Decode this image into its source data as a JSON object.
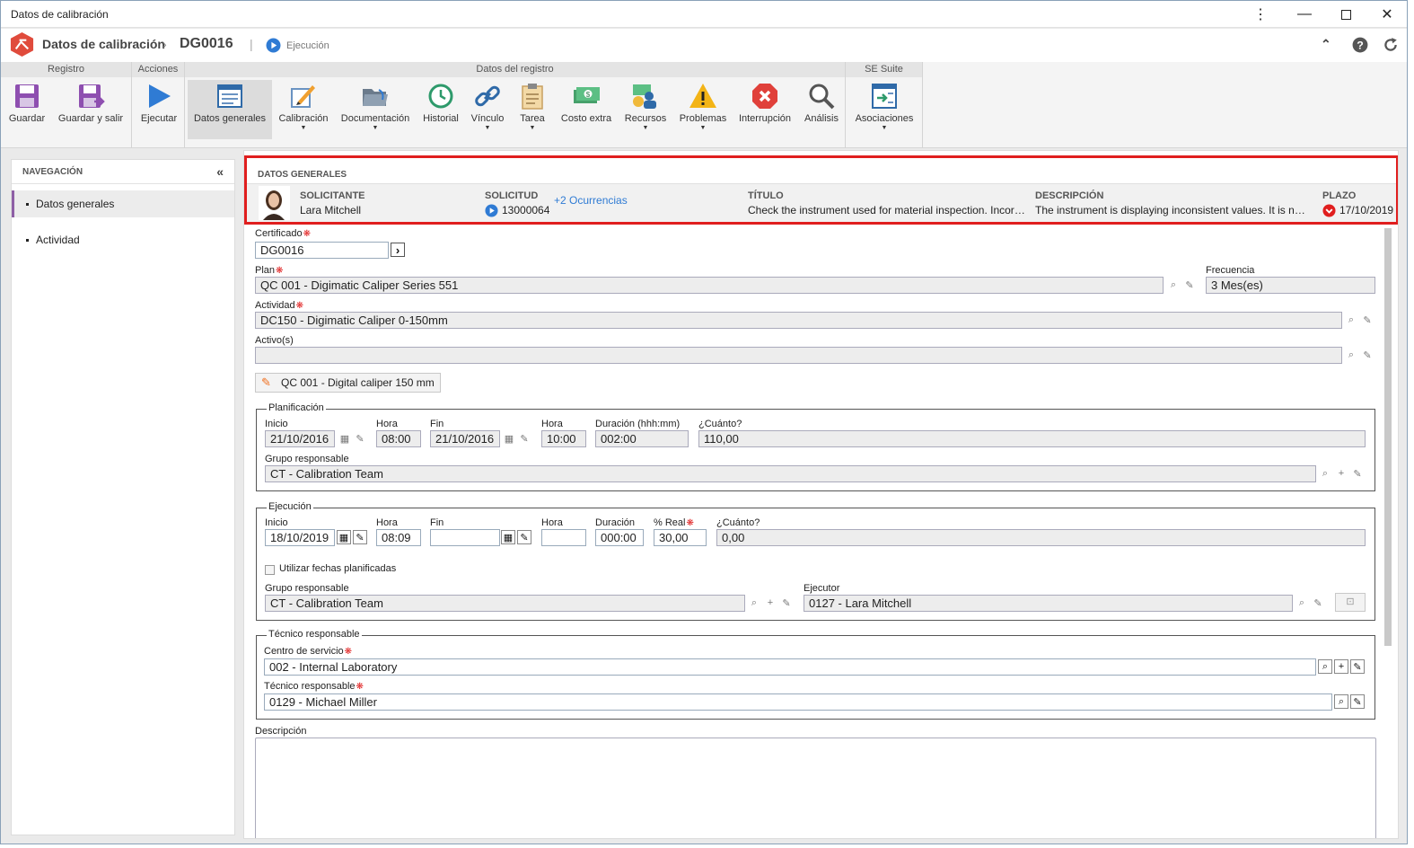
{
  "window": {
    "title": "Datos de calibración"
  },
  "header": {
    "breadcrumb_root": "Datos de calibración",
    "record_id": "DG0016",
    "status": "Ejecución"
  },
  "ribbon": {
    "groups": [
      {
        "label": "Registro"
      },
      {
        "label": "Acciones"
      },
      {
        "label": "Datos del registro"
      },
      {
        "label": "SE Suite"
      }
    ],
    "buttons": [
      {
        "label": "Guardar",
        "icon": "save-icon"
      },
      {
        "label": "Guardar y salir",
        "icon": "save-exit-icon"
      },
      {
        "label": "Ejecutar",
        "icon": "play-icon"
      },
      {
        "label": "Datos generales",
        "icon": "form-icon"
      },
      {
        "label": "Calibración",
        "icon": "calibration-icon"
      },
      {
        "label": "Documentación",
        "icon": "folder-icon"
      },
      {
        "label": "Historial",
        "icon": "history-icon"
      },
      {
        "label": "Vínculo",
        "icon": "link-icon"
      },
      {
        "label": "Tarea",
        "icon": "clipboard-icon"
      },
      {
        "label": "Costo extra",
        "icon": "money-icon"
      },
      {
        "label": "Recursos",
        "icon": "resources-icon"
      },
      {
        "label": "Problemas",
        "icon": "warning-icon"
      },
      {
        "label": "Interrupción",
        "icon": "stop-icon"
      },
      {
        "label": "Análisis",
        "icon": "magnifier-icon"
      },
      {
        "label": "Asociaciones",
        "icon": "associations-icon"
      }
    ]
  },
  "nav": {
    "title": "NAVEGACIÓN",
    "items": [
      {
        "label": "Datos generales"
      },
      {
        "label": "Actividad"
      }
    ]
  },
  "summary": {
    "title": "DATOS GENERALES",
    "solicitante_h": "SOLICITANTE",
    "solicitante": "Lara Mitchell",
    "solicitud_h": "SOLICITUD",
    "solicitud": "13000064",
    "ocurrencias": "+2 Ocurrencias",
    "titulo_h": "TÍTULO",
    "titulo": "Check the instrument used for material inspection. Incorrect values",
    "descripcion_h": "DESCRIPCIÓN",
    "descripcion": "The instrument is displaying inconsistent values. It is necessary to check it",
    "plazo_h": "PLAZO",
    "plazo": "17/10/2019"
  },
  "form": {
    "certificado_l": "Certificado",
    "certificado": "DG0016",
    "plan_l": "Plan",
    "plan": "QC 001 - Digimatic Caliper Series 551",
    "frecuencia_l": "Frecuencia",
    "frecuencia": "3 Mes(es)",
    "actividad_l": "Actividad",
    "actividad": "DC150 - Digimatic Caliper 0-150mm",
    "activos_l": "Activo(s)",
    "activos": "",
    "asset_chip": "QC 001 - Digital caliper 150 mm",
    "planificacion": {
      "legend": "Planificación",
      "inicio_l": "Inicio",
      "inicio": "21/10/2016",
      "hora_l": "Hora",
      "hora": "08:00",
      "fin_l": "Fin",
      "fin": "21/10/2016",
      "hora2_l": "Hora",
      "hora2": "10:00",
      "duracion_l": "Duración (hhh:mm)",
      "duracion": "002:00",
      "cuanto_l": "¿Cuánto?",
      "cuanto": "110,00",
      "grupo_l": "Grupo responsable",
      "grupo": "CT - Calibration Team"
    },
    "ejecucion": {
      "legend": "Ejecución",
      "inicio_l": "Inicio",
      "inicio": "18/10/2019",
      "hora_l": "Hora",
      "hora": "08:09",
      "fin_l": "Fin",
      "fin": "",
      "hora2_l": "Hora",
      "hora2": "",
      "duracion_l": "Duración",
      "duracion": "000:00",
      "real_l": "% Real",
      "real": "30,00",
      "cuanto_l": "¿Cuánto?",
      "cuanto": "0,00",
      "checkbox_l": "Utilizar fechas planificadas",
      "grupo_l": "Grupo responsable",
      "grupo": "CT - Calibration Team",
      "ejecutor_l": "Ejecutor",
      "ejecutor": "0127 - Lara Mitchell"
    },
    "tecnico": {
      "legend": "Técnico responsable",
      "centro_l": "Centro de servicio",
      "centro": "002 - Internal Laboratory",
      "tecnico_l": "Técnico responsable",
      "tecnico": "0129 - Michael Miller"
    },
    "descripcion_l": "Descripción"
  },
  "colors": {
    "accent": "#2f7bd4",
    "highlight": "#e01e1e",
    "nav_active": "#8e5fa6"
  }
}
